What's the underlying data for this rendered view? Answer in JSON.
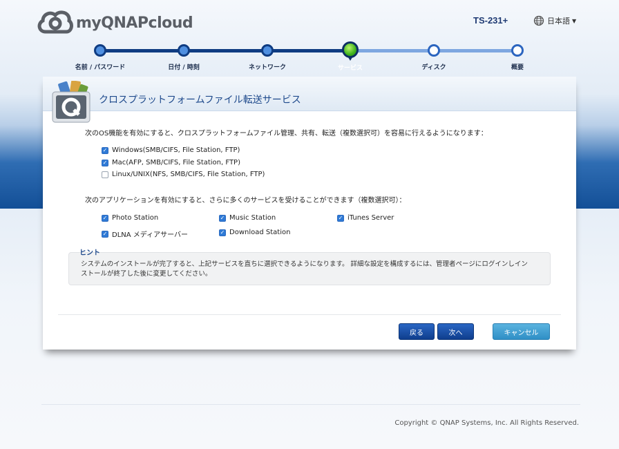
{
  "header": {
    "logo_text": "myQNAPcloud",
    "model": "TS-231+",
    "language": "日本語"
  },
  "steps": [
    {
      "label": "名前 / パスワード",
      "state": "done"
    },
    {
      "label": "日付 / 時刻",
      "state": "done"
    },
    {
      "label": "ネットワーク",
      "state": "done"
    },
    {
      "label": "サービス",
      "state": "current"
    },
    {
      "label": "ディスク",
      "state": "todo"
    },
    {
      "label": "概要",
      "state": "todo"
    }
  ],
  "card": {
    "title": "クロスプラットフォームファイル転送サービス",
    "os_intro": "次のOS機能を有効にすると、クロスプラットフォームファイル管理、共有、転送（複数選択可）を容易に行えるようになります：",
    "os_options": [
      {
        "label": "Windows(SMB/CIFS, File Station, FTP)",
        "checked": true
      },
      {
        "label": "Mac(AFP, SMB/CIFS, File Station, FTP)",
        "checked": true
      },
      {
        "label": "Linux/UNIX(NFS, SMB/CIFS, File Station, FTP)",
        "checked": false
      }
    ],
    "app_intro": "次のアプリケーションを有効にすると、さらに多くのサービスを受けることができます（複数選択可）：",
    "app_options": [
      {
        "label": "Photo Station",
        "checked": true
      },
      {
        "label": "Music Station",
        "checked": true
      },
      {
        "label": "iTunes Server",
        "checked": true
      },
      {
        "label": "DLNA メディアサーバー",
        "checked": true
      },
      {
        "label": "Download Station",
        "checked": true
      }
    ],
    "hint_title": "ヒント",
    "hint_line1": "システムのインストールが完了すると、上記サービスを直ちに選択できるようになります。 詳細な設定を構成するには、管理者ページにログインしイン",
    "hint_line2": "ストールが終了した後に変更してください。"
  },
  "buttons": {
    "back": "戻る",
    "next": "次へ",
    "cancel": "キャンセル"
  },
  "footer": {
    "copyright": "Copyright © QNAP Systems, Inc. All Rights Reserved."
  }
}
